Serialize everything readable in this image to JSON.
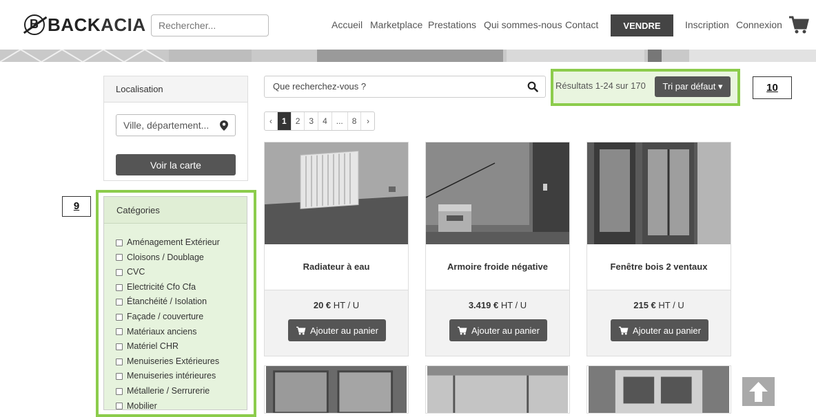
{
  "header": {
    "logo_text": "BACKACIA",
    "logo_text_b1": "BACK",
    "logo_text_b2": "ACIA",
    "logo_mark": "B",
    "search_placeholder": "Rechercher...",
    "nav": [
      "Accueil",
      "Marketplace",
      "Prestations",
      "Qui sommes-nous",
      "Contact"
    ],
    "vendre": "VENDRE",
    "inscription": "Inscription",
    "connexion": "Connexion",
    "cart_icon": "shopping-cart-icon"
  },
  "sidebar": {
    "localisation_title": "Localisation",
    "location_placeholder": "Ville, département...",
    "map_button": "Voir la carte",
    "categories_title": "Catégories",
    "categories": [
      "Aménagement Extérieur",
      "Cloisons / Doublage",
      "CVC",
      "Electricité Cfo Cfa",
      "Étanchéité / Isolation",
      "Façade / couverture",
      "Matériaux anciens",
      "Matériel CHR",
      "Menuiseries Extérieures",
      "Menuiseries intérieures",
      "Métallerie / Serrurerie",
      "Mobilier"
    ]
  },
  "main": {
    "search_placeholder": "Que recherchez-vous ?",
    "results_text": "Résultats 1-24 sur 170",
    "sort_label": "Tri par défaut",
    "pagination": [
      "‹",
      "1",
      "2",
      "3",
      "4",
      "...",
      "8",
      "›"
    ],
    "active_page": "1",
    "products": [
      {
        "title": "Radiateur à eau",
        "price": "20 €",
        "unit": "HT / U",
        "cart_label": "Ajouter au panier"
      },
      {
        "title": "Armoire froide négative",
        "price": "3.419 €",
        "unit": "HT / U",
        "cart_label": "Ajouter au panier"
      },
      {
        "title": "Fenêtre bois 2 ventaux",
        "price": "215 €",
        "unit": "HT / U",
        "cart_label": "Ajouter au panier"
      }
    ]
  },
  "annotations": {
    "label_9": "9",
    "label_10": "10"
  },
  "colors": {
    "highlight_green": "#8ccc4c",
    "button_dark": "#555555",
    "vendre_bg": "#444444"
  }
}
